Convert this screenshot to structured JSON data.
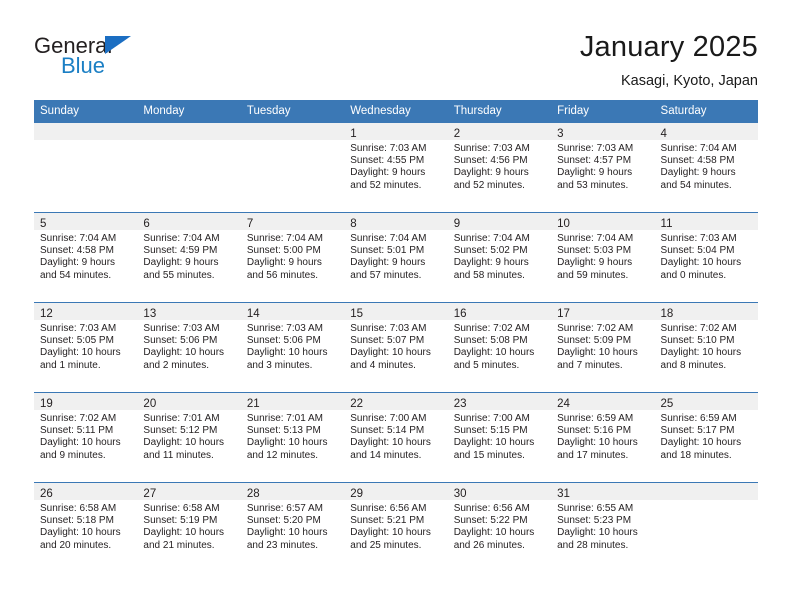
{
  "brand": {
    "name_part1": "General",
    "name_part2": "Blue",
    "logo_icon": "triangle-flag-icon"
  },
  "header": {
    "title": "January 2025",
    "subtitle": "Kasagi, Kyoto, Japan"
  },
  "calendar": {
    "weekday_headers": [
      "Sunday",
      "Monday",
      "Tuesday",
      "Wednesday",
      "Thursday",
      "Friday",
      "Saturday"
    ],
    "accent_color": "#3b78b5",
    "daynum_band_color": "#f0f0f0",
    "weeks": [
      [
        {
          "day": "",
          "sunrise": "",
          "sunset": "",
          "daylight_line1": "",
          "daylight_line2": ""
        },
        {
          "day": "",
          "sunrise": "",
          "sunset": "",
          "daylight_line1": "",
          "daylight_line2": ""
        },
        {
          "day": "",
          "sunrise": "",
          "sunset": "",
          "daylight_line1": "",
          "daylight_line2": ""
        },
        {
          "day": "1",
          "sunrise": "Sunrise: 7:03 AM",
          "sunset": "Sunset: 4:55 PM",
          "daylight_line1": "Daylight: 9 hours",
          "daylight_line2": "and 52 minutes."
        },
        {
          "day": "2",
          "sunrise": "Sunrise: 7:03 AM",
          "sunset": "Sunset: 4:56 PM",
          "daylight_line1": "Daylight: 9 hours",
          "daylight_line2": "and 52 minutes."
        },
        {
          "day": "3",
          "sunrise": "Sunrise: 7:03 AM",
          "sunset": "Sunset: 4:57 PM",
          "daylight_line1": "Daylight: 9 hours",
          "daylight_line2": "and 53 minutes."
        },
        {
          "day": "4",
          "sunrise": "Sunrise: 7:04 AM",
          "sunset": "Sunset: 4:58 PM",
          "daylight_line1": "Daylight: 9 hours",
          "daylight_line2": "and 54 minutes."
        }
      ],
      [
        {
          "day": "5",
          "sunrise": "Sunrise: 7:04 AM",
          "sunset": "Sunset: 4:58 PM",
          "daylight_line1": "Daylight: 9 hours",
          "daylight_line2": "and 54 minutes."
        },
        {
          "day": "6",
          "sunrise": "Sunrise: 7:04 AM",
          "sunset": "Sunset: 4:59 PM",
          "daylight_line1": "Daylight: 9 hours",
          "daylight_line2": "and 55 minutes."
        },
        {
          "day": "7",
          "sunrise": "Sunrise: 7:04 AM",
          "sunset": "Sunset: 5:00 PM",
          "daylight_line1": "Daylight: 9 hours",
          "daylight_line2": "and 56 minutes."
        },
        {
          "day": "8",
          "sunrise": "Sunrise: 7:04 AM",
          "sunset": "Sunset: 5:01 PM",
          "daylight_line1": "Daylight: 9 hours",
          "daylight_line2": "and 57 minutes."
        },
        {
          "day": "9",
          "sunrise": "Sunrise: 7:04 AM",
          "sunset": "Sunset: 5:02 PM",
          "daylight_line1": "Daylight: 9 hours",
          "daylight_line2": "and 58 minutes."
        },
        {
          "day": "10",
          "sunrise": "Sunrise: 7:04 AM",
          "sunset": "Sunset: 5:03 PM",
          "daylight_line1": "Daylight: 9 hours",
          "daylight_line2": "and 59 minutes."
        },
        {
          "day": "11",
          "sunrise": "Sunrise: 7:03 AM",
          "sunset": "Sunset: 5:04 PM",
          "daylight_line1": "Daylight: 10 hours",
          "daylight_line2": "and 0 minutes."
        }
      ],
      [
        {
          "day": "12",
          "sunrise": "Sunrise: 7:03 AM",
          "sunset": "Sunset: 5:05 PM",
          "daylight_line1": "Daylight: 10 hours",
          "daylight_line2": "and 1 minute."
        },
        {
          "day": "13",
          "sunrise": "Sunrise: 7:03 AM",
          "sunset": "Sunset: 5:06 PM",
          "daylight_line1": "Daylight: 10 hours",
          "daylight_line2": "and 2 minutes."
        },
        {
          "day": "14",
          "sunrise": "Sunrise: 7:03 AM",
          "sunset": "Sunset: 5:06 PM",
          "daylight_line1": "Daylight: 10 hours",
          "daylight_line2": "and 3 minutes."
        },
        {
          "day": "15",
          "sunrise": "Sunrise: 7:03 AM",
          "sunset": "Sunset: 5:07 PM",
          "daylight_line1": "Daylight: 10 hours",
          "daylight_line2": "and 4 minutes."
        },
        {
          "day": "16",
          "sunrise": "Sunrise: 7:02 AM",
          "sunset": "Sunset: 5:08 PM",
          "daylight_line1": "Daylight: 10 hours",
          "daylight_line2": "and 5 minutes."
        },
        {
          "day": "17",
          "sunrise": "Sunrise: 7:02 AM",
          "sunset": "Sunset: 5:09 PM",
          "daylight_line1": "Daylight: 10 hours",
          "daylight_line2": "and 7 minutes."
        },
        {
          "day": "18",
          "sunrise": "Sunrise: 7:02 AM",
          "sunset": "Sunset: 5:10 PM",
          "daylight_line1": "Daylight: 10 hours",
          "daylight_line2": "and 8 minutes."
        }
      ],
      [
        {
          "day": "19",
          "sunrise": "Sunrise: 7:02 AM",
          "sunset": "Sunset: 5:11 PM",
          "daylight_line1": "Daylight: 10 hours",
          "daylight_line2": "and 9 minutes."
        },
        {
          "day": "20",
          "sunrise": "Sunrise: 7:01 AM",
          "sunset": "Sunset: 5:12 PM",
          "daylight_line1": "Daylight: 10 hours",
          "daylight_line2": "and 11 minutes."
        },
        {
          "day": "21",
          "sunrise": "Sunrise: 7:01 AM",
          "sunset": "Sunset: 5:13 PM",
          "daylight_line1": "Daylight: 10 hours",
          "daylight_line2": "and 12 minutes."
        },
        {
          "day": "22",
          "sunrise": "Sunrise: 7:00 AM",
          "sunset": "Sunset: 5:14 PM",
          "daylight_line1": "Daylight: 10 hours",
          "daylight_line2": "and 14 minutes."
        },
        {
          "day": "23",
          "sunrise": "Sunrise: 7:00 AM",
          "sunset": "Sunset: 5:15 PM",
          "daylight_line1": "Daylight: 10 hours",
          "daylight_line2": "and 15 minutes."
        },
        {
          "day": "24",
          "sunrise": "Sunrise: 6:59 AM",
          "sunset": "Sunset: 5:16 PM",
          "daylight_line1": "Daylight: 10 hours",
          "daylight_line2": "and 17 minutes."
        },
        {
          "day": "25",
          "sunrise": "Sunrise: 6:59 AM",
          "sunset": "Sunset: 5:17 PM",
          "daylight_line1": "Daylight: 10 hours",
          "daylight_line2": "and 18 minutes."
        }
      ],
      [
        {
          "day": "26",
          "sunrise": "Sunrise: 6:58 AM",
          "sunset": "Sunset: 5:18 PM",
          "daylight_line1": "Daylight: 10 hours",
          "daylight_line2": "and 20 minutes."
        },
        {
          "day": "27",
          "sunrise": "Sunrise: 6:58 AM",
          "sunset": "Sunset: 5:19 PM",
          "daylight_line1": "Daylight: 10 hours",
          "daylight_line2": "and 21 minutes."
        },
        {
          "day": "28",
          "sunrise": "Sunrise: 6:57 AM",
          "sunset": "Sunset: 5:20 PM",
          "daylight_line1": "Daylight: 10 hours",
          "daylight_line2": "and 23 minutes."
        },
        {
          "day": "29",
          "sunrise": "Sunrise: 6:56 AM",
          "sunset": "Sunset: 5:21 PM",
          "daylight_line1": "Daylight: 10 hours",
          "daylight_line2": "and 25 minutes."
        },
        {
          "day": "30",
          "sunrise": "Sunrise: 6:56 AM",
          "sunset": "Sunset: 5:22 PM",
          "daylight_line1": "Daylight: 10 hours",
          "daylight_line2": "and 26 minutes."
        },
        {
          "day": "31",
          "sunrise": "Sunrise: 6:55 AM",
          "sunset": "Sunset: 5:23 PM",
          "daylight_line1": "Daylight: 10 hours",
          "daylight_line2": "and 28 minutes."
        },
        {
          "day": "",
          "sunrise": "",
          "sunset": "",
          "daylight_line1": "",
          "daylight_line2": ""
        }
      ]
    ]
  }
}
